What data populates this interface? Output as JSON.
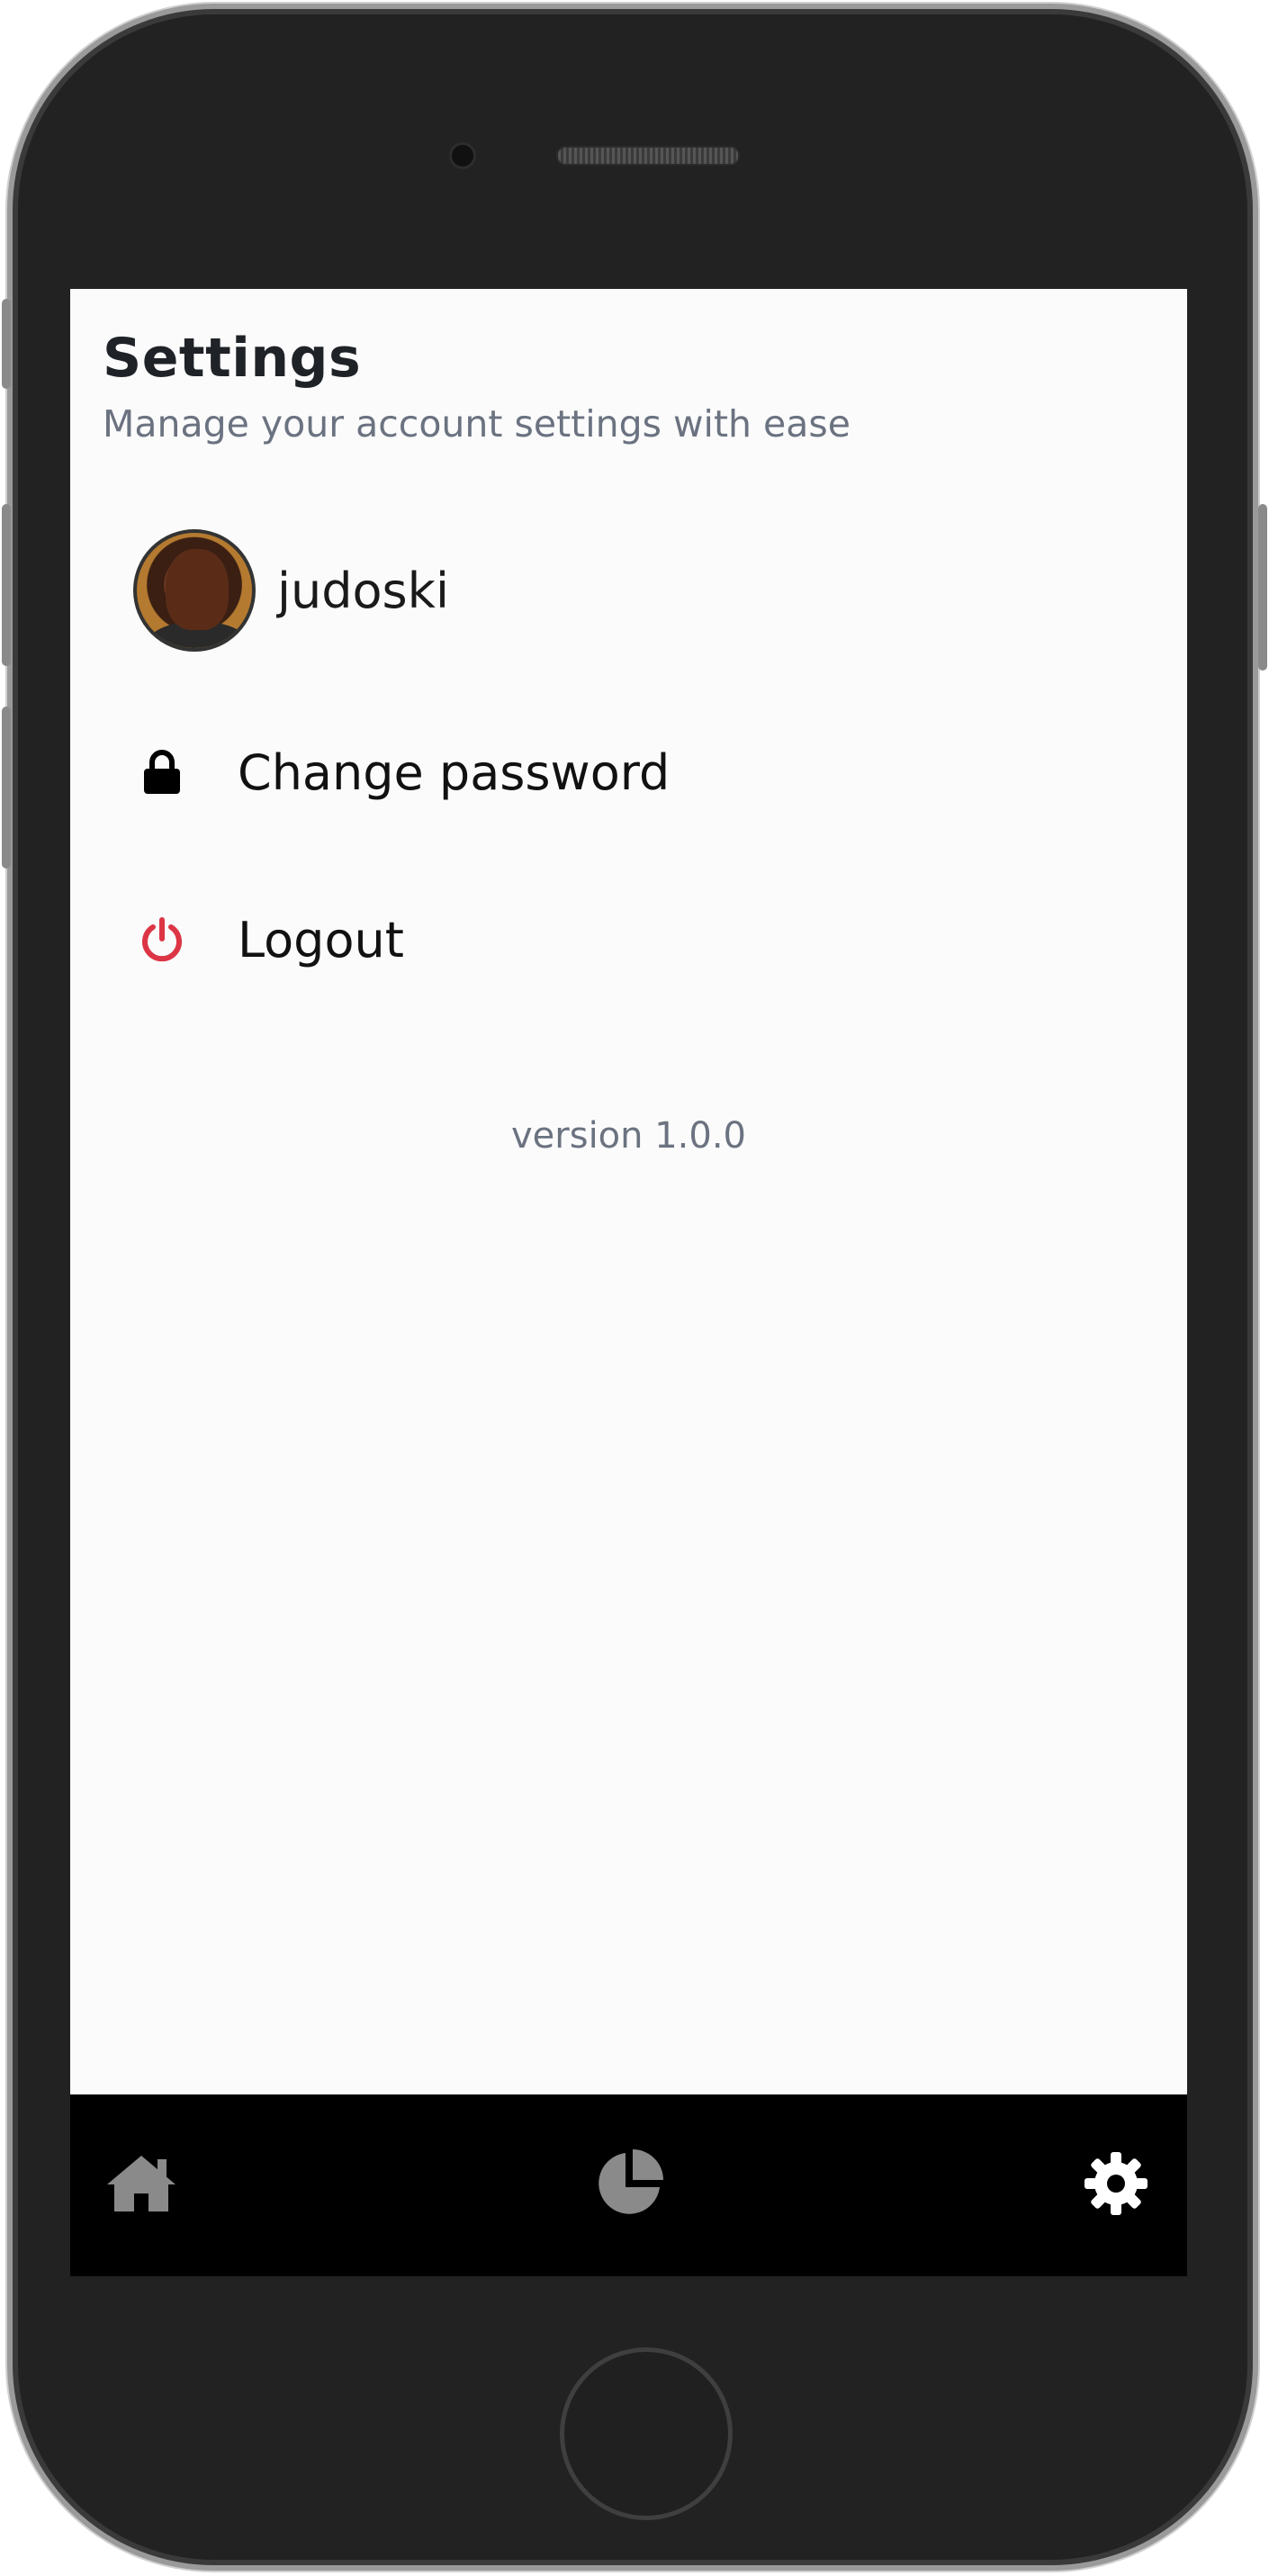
{
  "screen": {
    "title": "Settings",
    "subtitle": "Manage your account settings with ease"
  },
  "profile": {
    "username": "judoski",
    "avatar_alt": "User avatar"
  },
  "menu": [
    {
      "label": "Change password",
      "icon": "lock-icon",
      "icon_color": "#000000"
    },
    {
      "label": "Logout",
      "icon": "power-icon",
      "icon_color": "#dc3545"
    }
  ],
  "version_text": "version 1.0.0",
  "bottom_nav": {
    "items": [
      {
        "icon": "home-icon",
        "color": "#8a8a8a",
        "active": false
      },
      {
        "icon": "pie-chart-icon",
        "color": "#8a8a8a",
        "active": false
      },
      {
        "icon": "gear-icon",
        "color": "#ffffff",
        "active": true
      }
    ]
  },
  "colors": {
    "background": "#fbfbfb",
    "title": "#1f2328",
    "muted": "#6b7280",
    "danger": "#dc3545",
    "nav_bg": "#000000"
  }
}
